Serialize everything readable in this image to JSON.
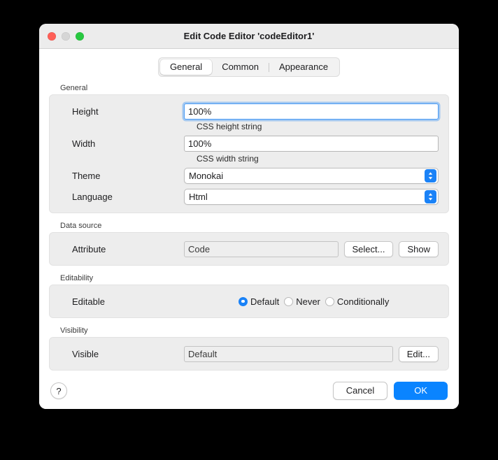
{
  "window": {
    "title": "Edit Code Editor 'codeEditor1'",
    "traffic_lights": [
      {
        "name": "close",
        "color": "#ff5f57"
      },
      {
        "name": "minimize",
        "color": "#d6d6d6"
      },
      {
        "name": "zoom",
        "color": "#28c840"
      }
    ]
  },
  "tabs": [
    {
      "label": "General",
      "selected": true
    },
    {
      "label": "Common",
      "selected": false
    },
    {
      "label": "Appearance",
      "selected": false
    }
  ],
  "sections": {
    "general": {
      "title": "General",
      "height": {
        "label": "Height",
        "value": "100%",
        "hint": "CSS height string"
      },
      "width": {
        "label": "Width",
        "value": "100%",
        "hint": "CSS width string"
      },
      "theme": {
        "label": "Theme",
        "value": "Monokai"
      },
      "language": {
        "label": "Language",
        "value": "Html"
      }
    },
    "data_source": {
      "title": "Data source",
      "attribute": {
        "label": "Attribute",
        "value": "Code"
      },
      "select_button": "Select...",
      "show_button": "Show"
    },
    "editability": {
      "title": "Editability",
      "editable": {
        "label": "Editable",
        "options": [
          {
            "label": "Default",
            "selected": true
          },
          {
            "label": "Never",
            "selected": false
          },
          {
            "label": "Conditionally",
            "selected": false
          }
        ]
      }
    },
    "visibility": {
      "title": "Visibility",
      "visible": {
        "label": "Visible",
        "value": "Default"
      },
      "edit_button": "Edit..."
    }
  },
  "footer": {
    "help_label": "?",
    "cancel_label": "Cancel",
    "ok_label": "OK"
  },
  "colors": {
    "accent": "#0a84ff",
    "focus_ring": "#4a9bf5",
    "group_bg": "#ededed"
  }
}
